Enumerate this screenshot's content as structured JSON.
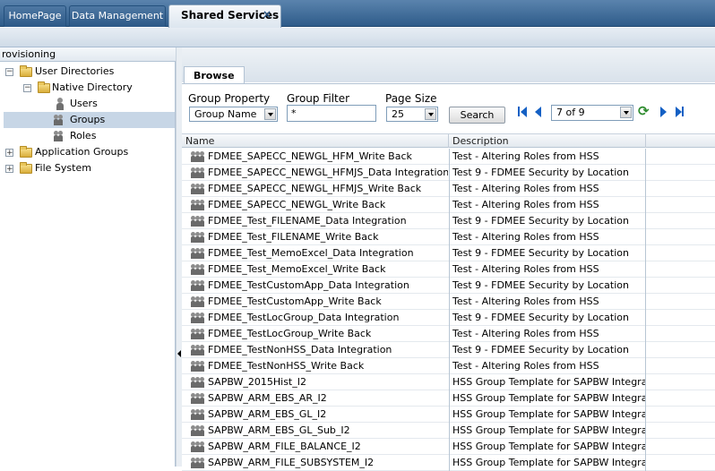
{
  "tabs": [
    {
      "label": "HomePage"
    },
    {
      "label": "Data Management"
    },
    {
      "label": "Shared Services",
      "close_glyph": "×"
    }
  ],
  "left_panel": {
    "header": "rovisioning",
    "tree": [
      {
        "label": "User Directories",
        "expander": "−",
        "icon": "folder-icon"
      },
      {
        "label": "Native Directory",
        "expander": "−",
        "icon": "folder-icon"
      },
      {
        "label": "Users",
        "icon": "user-icon"
      },
      {
        "label": "Groups",
        "icon": "group-icon",
        "selected": true
      },
      {
        "label": "Roles",
        "icon": "role-icon"
      },
      {
        "label": "Application Groups",
        "expander": "+",
        "icon": "folder-icon"
      },
      {
        "label": "File System",
        "expander": "+",
        "icon": "folder-icon"
      }
    ]
  },
  "browse": {
    "tab_label": "Browse",
    "group_property": {
      "label": "Group Property",
      "value": "Group Name"
    },
    "group_filter": {
      "label": "Group Filter",
      "value": "*"
    },
    "page_size": {
      "label": "Page Size",
      "value": "25"
    },
    "search_label": "Search",
    "page_indicator": "7 of 9"
  },
  "table": {
    "columns": [
      "Name",
      "Description"
    ],
    "rows": [
      {
        "name": "FDMEE_SAPECC_NEWGL_HFM_Write Back",
        "description": "Test - Altering Roles from HSS"
      },
      {
        "name": "FDMEE_SAPECC_NEWGL_HFMJS_Data Integration",
        "description": "Test 9 - FDMEE Security by Location"
      },
      {
        "name": "FDMEE_SAPECC_NEWGL_HFMJS_Write Back",
        "description": "Test - Altering Roles from HSS"
      },
      {
        "name": "FDMEE_SAPECC_NEWGL_Write Back",
        "description": "Test - Altering Roles from HSS"
      },
      {
        "name": "FDMEE_Test_FILENAME_Data Integration",
        "description": "Test 9 - FDMEE Security by Location"
      },
      {
        "name": "FDMEE_Test_FILENAME_Write Back",
        "description": "Test - Altering Roles from HSS"
      },
      {
        "name": "FDMEE_Test_MemoExcel_Data Integration",
        "description": "Test 9 - FDMEE Security by Location"
      },
      {
        "name": "FDMEE_Test_MemoExcel_Write Back",
        "description": "Test - Altering Roles from HSS"
      },
      {
        "name": "FDMEE_TestCustomApp_Data Integration",
        "description": "Test 9 - FDMEE Security by Location"
      },
      {
        "name": "FDMEE_TestCustomApp_Write Back",
        "description": "Test - Altering Roles from HSS"
      },
      {
        "name": "FDMEE_TestLocGroup_Data Integration",
        "description": "Test 9 - FDMEE Security by Location"
      },
      {
        "name": "FDMEE_TestLocGroup_Write Back",
        "description": "Test - Altering Roles from HSS"
      },
      {
        "name": "FDMEE_TestNonHSS_Data Integration",
        "description": "Test 9 - FDMEE Security by Location"
      },
      {
        "name": "FDMEE_TestNonHSS_Write Back",
        "description": "Test - Altering Roles from HSS"
      },
      {
        "name": "SAPBW_2015Hist_I2",
        "description": "HSS Group Template for SAPBW Integration"
      },
      {
        "name": "SAPBW_ARM_EBS_AR_I2",
        "description": "HSS Group Template for SAPBW Integration"
      },
      {
        "name": "SAPBW_ARM_EBS_GL_I2",
        "description": "HSS Group Template for SAPBW Integration"
      },
      {
        "name": "SAPBW_ARM_EBS_GL_Sub_I2",
        "description": "HSS Group Template for SAPBW Integration"
      },
      {
        "name": "SAPBW_ARM_FILE_BALANCE_I2",
        "description": "HSS Group Template for SAPBW Integration"
      },
      {
        "name": "SAPBW_ARM_FILE_SUBSYSTEM_I2",
        "description": "HSS Group Template for SAPBW Integration"
      }
    ]
  }
}
